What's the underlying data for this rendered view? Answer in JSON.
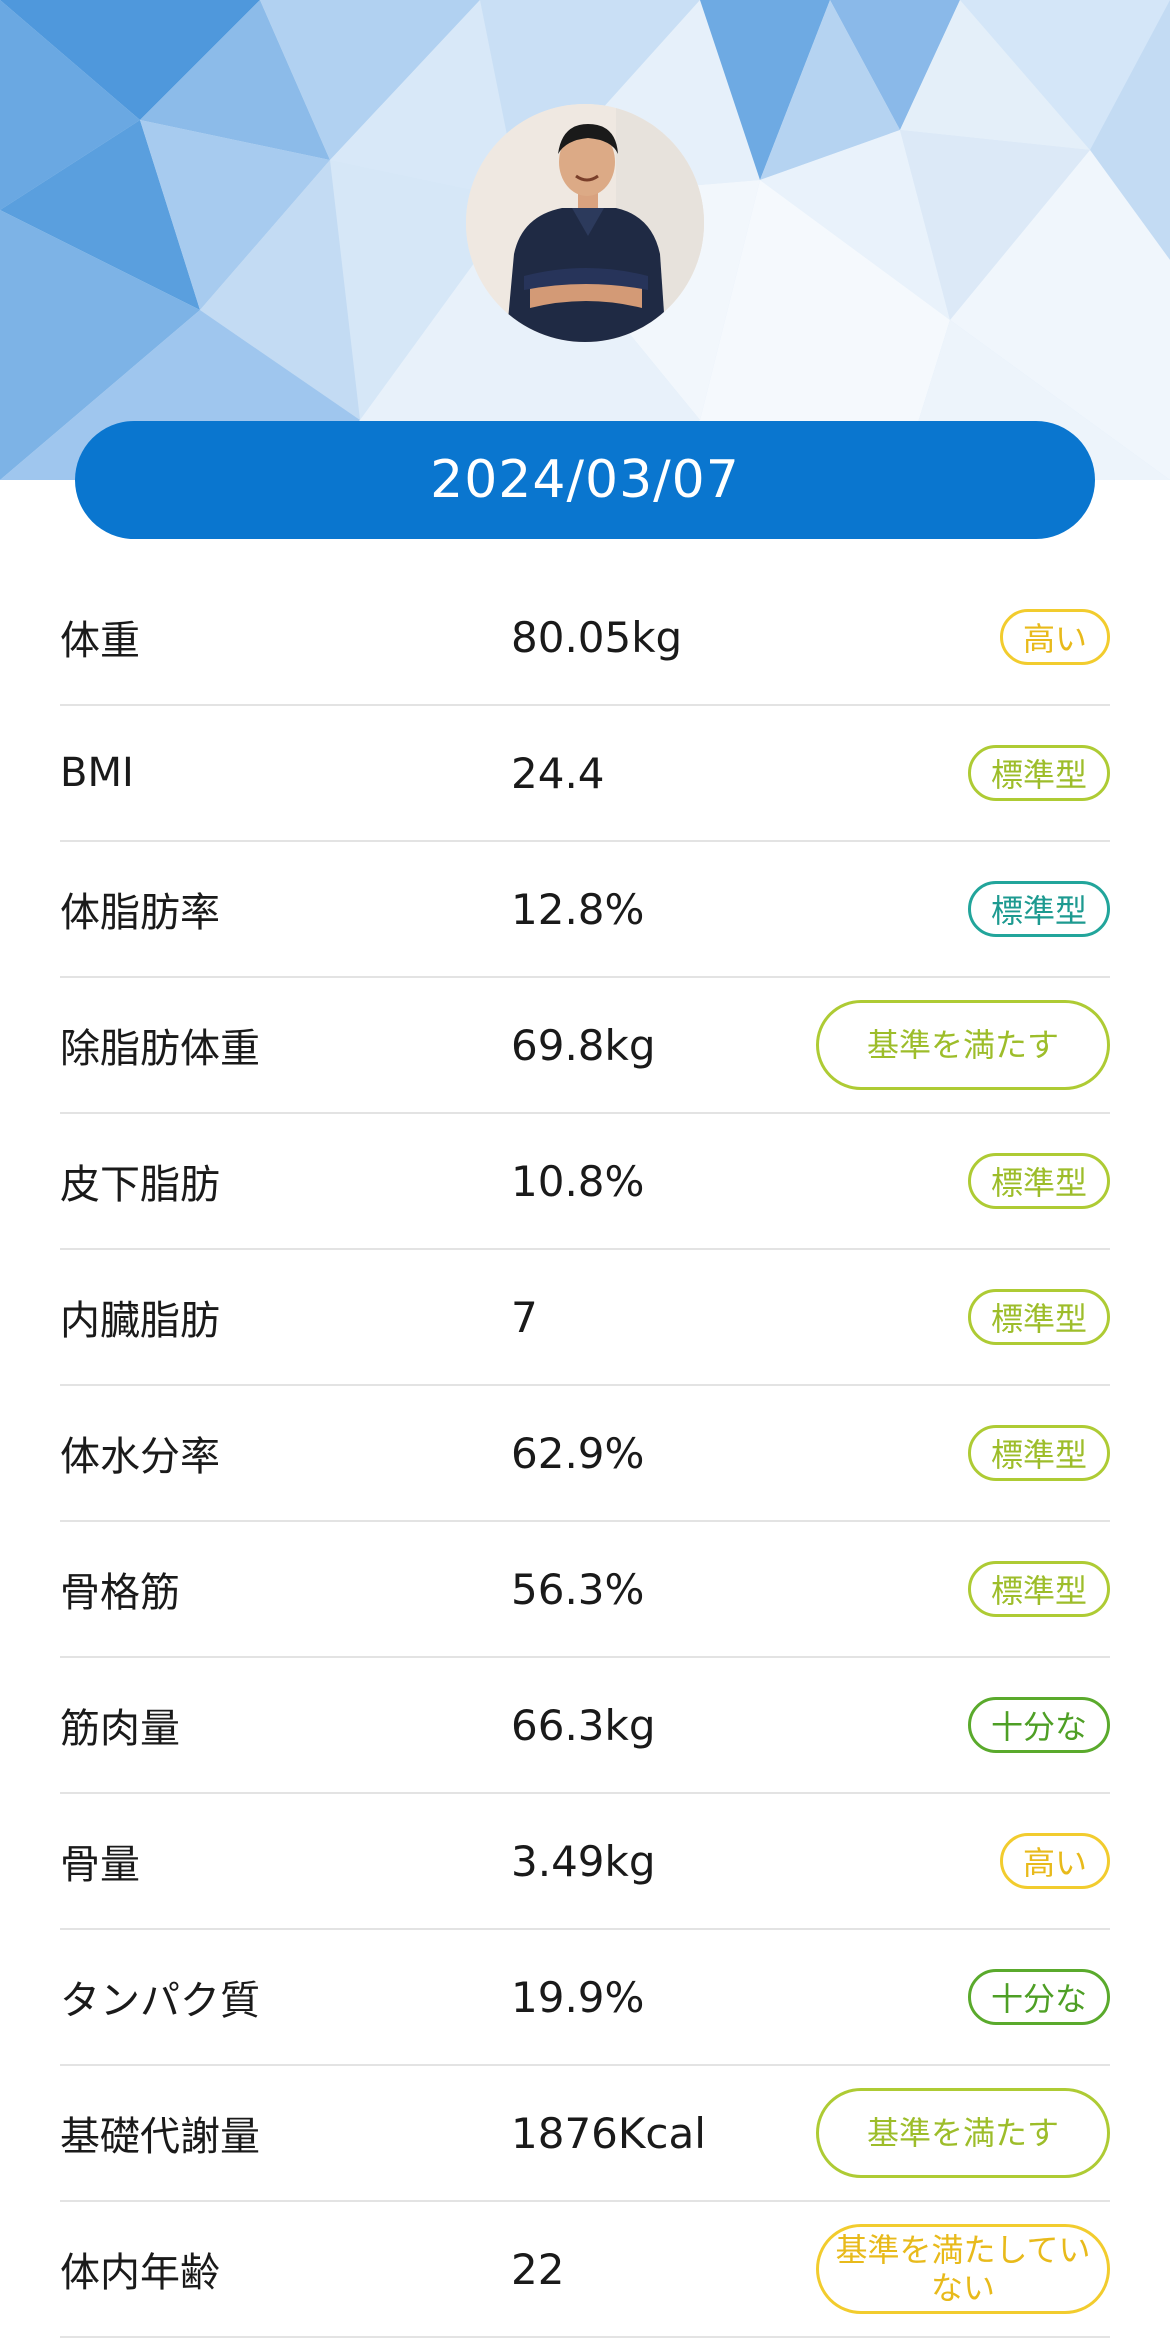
{
  "header": {
    "date": "2024/03/07",
    "colors": {
      "accent": "#0a76cf",
      "hero_background": "#cfe3f6"
    }
  },
  "metrics": [
    {
      "label": "体重",
      "value": "80.05kg",
      "status": "高い",
      "status_color": "#f2cc2e"
    },
    {
      "label": "BMI",
      "value": "24.4",
      "status": "標準型",
      "status_color": "#aecb34"
    },
    {
      "label": "体脂肪率",
      "value": "12.8%",
      "status": "標準型",
      "status_color": "#22a59b"
    },
    {
      "label": "除脂肪体重",
      "value": "69.8kg",
      "status": "基準を満たす",
      "status_color": "#aecb34"
    },
    {
      "label": "皮下脂肪",
      "value": "10.8%",
      "status": "標準型",
      "status_color": "#aecb34"
    },
    {
      "label": "内臓脂肪",
      "value": "7",
      "status": "標準型",
      "status_color": "#aecb34"
    },
    {
      "label": "体水分率",
      "value": "62.9%",
      "status": "標準型",
      "status_color": "#aecb34"
    },
    {
      "label": "骨格筋",
      "value": "56.3%",
      "status": "標準型",
      "status_color": "#aecb34"
    },
    {
      "label": "筋肉量",
      "value": "66.3kg",
      "status": "十分な",
      "status_color": "#5aaa2c"
    },
    {
      "label": "骨量",
      "value": "3.49kg",
      "status": "高い",
      "status_color": "#f2cc2e"
    },
    {
      "label": "タンパク質",
      "value": "19.9%",
      "status": "十分な",
      "status_color": "#5aaa2c"
    },
    {
      "label": "基礎代謝量",
      "value": "1876Kcal",
      "status": "基準を満たす",
      "status_color": "#aecb34"
    },
    {
      "label": "体内年齢",
      "value": "22",
      "status": "基準を満たしていない",
      "status_color": "#f2cc2e"
    }
  ]
}
